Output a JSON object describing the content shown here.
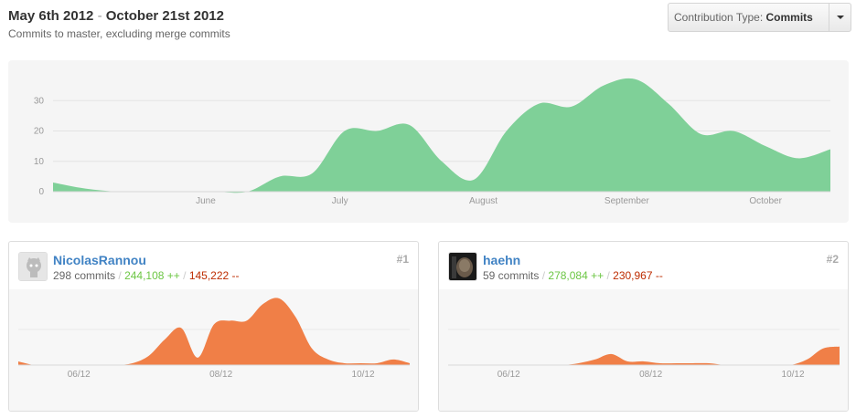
{
  "header": {
    "start_date": "May 6th 2012",
    "separator": "-",
    "end_date": "October 21st 2012",
    "subtitle": "Commits to master, excluding merge commits"
  },
  "contribution_button": {
    "label": "Contribution Type:",
    "value": "Commits",
    "caret_icon": "caret-down-icon"
  },
  "colors": {
    "main_area": "#7fd098",
    "card_area": "#f07f47"
  },
  "chart_data": [
    {
      "type": "area",
      "title": "",
      "xlabel": "",
      "ylabel": "",
      "ylim": [
        0,
        37
      ],
      "yticks": [
        "0",
        "10",
        "20",
        "30"
      ],
      "xticks": [
        "June",
        "July",
        "August",
        "September",
        "October"
      ],
      "grid": true,
      "x": [
        "2012-05-06",
        "2012-05-13",
        "2012-05-20",
        "2012-05-27",
        "2012-06-03",
        "2012-06-10",
        "2012-06-17",
        "2012-06-24",
        "2012-07-01",
        "2012-07-08",
        "2012-07-15",
        "2012-07-22",
        "2012-07-29",
        "2012-08-05",
        "2012-08-12",
        "2012-08-19",
        "2012-08-26",
        "2012-09-02",
        "2012-09-09",
        "2012-09-16",
        "2012-09-23",
        "2012-09-30",
        "2012-10-07",
        "2012-10-14",
        "2012-10-21"
      ],
      "series": [
        {
          "values": [
            3,
            1,
            0,
            0,
            0,
            0,
            0,
            5,
            6,
            20,
            20,
            22,
            10,
            4,
            20,
            29,
            28,
            35,
            37,
            29,
            19,
            20,
            15,
            11,
            14
          ]
        }
      ]
    },
    {
      "type": "area",
      "title": "",
      "xticks": [
        "06/12",
        "08/12",
        "10/12"
      ],
      "x": [
        "2012-05-06",
        "2012-05-13",
        "2012-05-20",
        "2012-05-27",
        "2012-06-03",
        "2012-06-10",
        "2012-06-17",
        "2012-06-24",
        "2012-07-01",
        "2012-07-08",
        "2012-07-15",
        "2012-07-22",
        "2012-07-29",
        "2012-08-05",
        "2012-08-12",
        "2012-08-19",
        "2012-08-26",
        "2012-09-02",
        "2012-09-09",
        "2012-09-16",
        "2012-09-23",
        "2012-09-30",
        "2012-10-07",
        "2012-10-14",
        "2012-10-21"
      ],
      "ylim": [
        0,
        37
      ],
      "series": [
        {
          "values": [
            2,
            0,
            0,
            0,
            0,
            0,
            0,
            1,
            5,
            14,
            20,
            4,
            22,
            24,
            24,
            33,
            36,
            26,
            9,
            3,
            1,
            1,
            1,
            3,
            1
          ]
        }
      ]
    },
    {
      "type": "area",
      "title": "",
      "xticks": [
        "06/12",
        "08/12",
        "10/12"
      ],
      "x": [
        "2012-05-06",
        "2012-05-13",
        "2012-05-20",
        "2012-05-27",
        "2012-06-03",
        "2012-06-10",
        "2012-06-17",
        "2012-06-24",
        "2012-07-01",
        "2012-07-08",
        "2012-07-15",
        "2012-07-22",
        "2012-07-29",
        "2012-08-05",
        "2012-08-12",
        "2012-08-19",
        "2012-08-26",
        "2012-09-02",
        "2012-09-09",
        "2012-09-16",
        "2012-09-23",
        "2012-09-30",
        "2012-10-07",
        "2012-10-14",
        "2012-10-21"
      ],
      "ylim": [
        0,
        37
      ],
      "series": [
        {
          "values": [
            0,
            0,
            0,
            0,
            0,
            0,
            0,
            0,
            1,
            3,
            6,
            2,
            2,
            1,
            1,
            1,
            1,
            0,
            0,
            0,
            0,
            0,
            3,
            9,
            10
          ]
        }
      ]
    }
  ],
  "contributors": [
    {
      "name": "NicolasRannou",
      "commits": "298 commits",
      "slash": "/",
      "additions": "244,108 ++",
      "deletions": "145,222 --",
      "rank": "#1",
      "avatar_icon": "octocat-avatar-icon"
    },
    {
      "name": "haehn",
      "commits": "59 commits",
      "slash": "/",
      "additions": "278,084 ++",
      "deletions": "230,967 --",
      "rank": "#2",
      "avatar_icon": "user-photo-avatar-icon"
    }
  ]
}
